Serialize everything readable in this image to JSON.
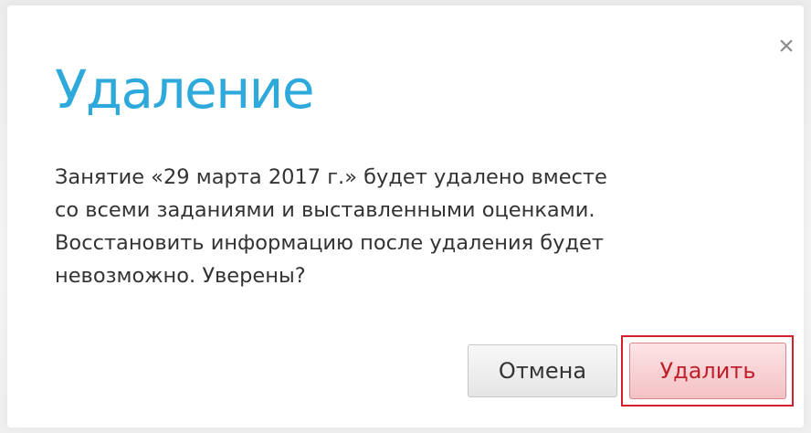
{
  "dialog": {
    "close_symbol": "×",
    "title": "Удаление",
    "message_lines": [
      "Занятие «29 марта 2017 г.» будет удалено вместе",
      "со всеми заданиями и выставленными оценками.",
      "Восстановить информацию после удаления будет",
      "невозможно. Уверены?"
    ],
    "buttons": {
      "cancel_label": "Отмена",
      "delete_label": "Удалить"
    },
    "icons": {
      "close": "close-icon"
    },
    "colors": {
      "title": "#2ea9dc",
      "delete_text": "#c0202b",
      "delete_focus_border": "#d61f2c"
    }
  }
}
